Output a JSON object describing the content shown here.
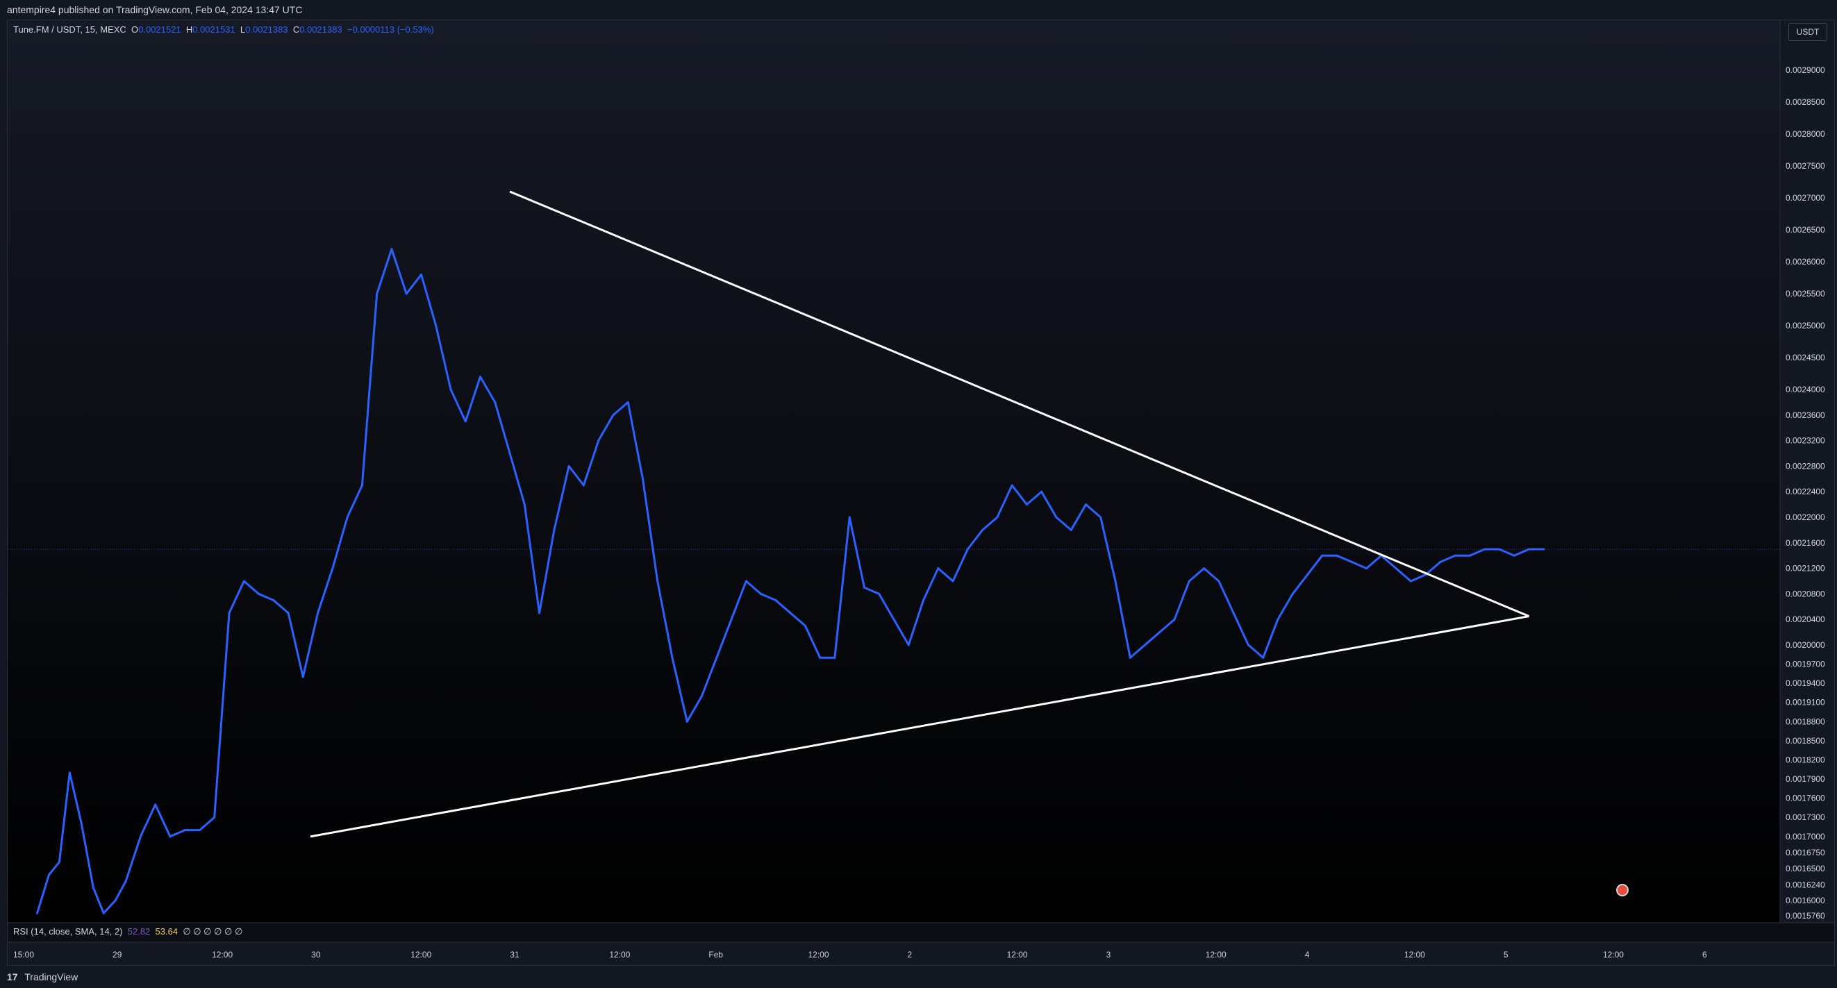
{
  "header": {
    "published": "antempire4 published on TradingView.com, Feb 04, 2024 13:47 UTC"
  },
  "legend": {
    "symbol": "Tune.FM / USDT, 15, MEXC",
    "o_label": "O",
    "o_value": "0.0021521",
    "h_label": "H",
    "h_value": "0.0021531",
    "l_label": "L",
    "l_value": "0.0021383",
    "c_label": "C",
    "c_value": "0.0021383",
    "change": "−0.0000113 (−0.53%)"
  },
  "rsi": {
    "label": "RSI (14, close, SMA, 14, 2)",
    "value1": "52.82",
    "value2": "53.64",
    "placeholders": "∅ ∅ ∅ ∅ ∅ ∅"
  },
  "currency": "USDT",
  "footer": {
    "brand": "TradingView",
    "logo": "17"
  },
  "colors": {
    "background": "#131722",
    "series": "#2962ff",
    "trendline": "#ffffff",
    "grid": "#1e222d",
    "text": "#d1d4dc",
    "crosshair": "#2962ff"
  },
  "chart_data": {
    "type": "line",
    "price_ticks": [
      "0.0029000",
      "0.0028500",
      "0.0028000",
      "0.0027500",
      "0.0027000",
      "0.0026500",
      "0.0026000",
      "0.0025500",
      "0.0025000",
      "0.0024500",
      "0.0024000",
      "0.0023600",
      "0.0023200",
      "0.0022800",
      "0.0022400",
      "0.0022000",
      "0.0021600",
      "0.0021200",
      "0.0020800",
      "0.0020400",
      "0.0020000",
      "0.0019700",
      "0.0019400",
      "0.0019100",
      "0.0018800",
      "0.0018500",
      "0.0018200",
      "0.0017900",
      "0.0017600",
      "0.0017300",
      "0.0017000",
      "0.0016750",
      "0.0016500",
      "0.0016240",
      "0.0016000",
      "0.0015760"
    ],
    "time_ticks": [
      "15:00",
      "29",
      "12:00",
      "30",
      "12:00",
      "31",
      "12:00",
      "Feb",
      "12:00",
      "2",
      "12:00",
      "3",
      "12:00",
      "4",
      "12:00",
      "5",
      "12:00",
      "6"
    ],
    "series": [
      {
        "x": [
          0,
          0.8,
          1.5,
          2.2,
          3,
          3.8,
          4.5,
          5.3,
          6,
          7,
          8,
          9,
          10,
          11,
          12,
          13,
          14,
          15,
          16,
          17,
          18,
          19,
          20,
          21,
          22,
          23,
          24,
          25,
          26,
          27,
          28,
          29,
          30,
          31,
          32,
          33,
          34,
          35,
          36,
          37,
          38,
          39,
          40,
          41,
          42,
          43,
          44,
          45,
          46,
          47,
          48,
          49,
          50,
          51,
          52,
          53,
          54,
          55,
          56,
          57,
          58,
          59,
          60,
          61,
          62,
          63,
          64,
          65,
          66,
          67,
          68,
          69,
          70,
          71,
          72,
          73,
          74,
          75,
          76,
          77,
          78,
          79,
          80,
          81,
          82,
          83,
          84,
          85,
          86,
          87,
          88,
          89,
          90,
          91,
          92,
          93,
          94,
          95,
          96,
          97,
          98,
          99,
          100,
          101,
          102
        ],
        "y": [
          0.00158,
          0.00164,
          0.00166,
          0.0018,
          0.00172,
          0.00162,
          0.00158,
          0.0016,
          0.00163,
          0.0017,
          0.00175,
          0.0017,
          0.00171,
          0.00171,
          0.00173,
          0.00205,
          0.0021,
          0.00208,
          0.00207,
          0.00205,
          0.00195,
          0.00205,
          0.00212,
          0.0022,
          0.00225,
          0.00255,
          0.00262,
          0.00255,
          0.00258,
          0.0025,
          0.0024,
          0.00235,
          0.00242,
          0.00238,
          0.0023,
          0.00222,
          0.00205,
          0.00218,
          0.00228,
          0.00225,
          0.00232,
          0.00236,
          0.00238,
          0.00226,
          0.0021,
          0.00198,
          0.00188,
          0.00192,
          0.00198,
          0.00204,
          0.0021,
          0.00208,
          0.00207,
          0.00205,
          0.00203,
          0.00198,
          0.00198,
          0.0022,
          0.00209,
          0.00208,
          0.00204,
          0.002,
          0.00207,
          0.00212,
          0.0021,
          0.00215,
          0.00218,
          0.0022,
          0.00225,
          0.00222,
          0.00224,
          0.0022,
          0.00218,
          0.00222,
          0.0022,
          0.0021,
          0.00198,
          0.002,
          0.00202,
          0.00204,
          0.0021,
          0.00212,
          0.0021,
          0.00205,
          0.002,
          0.00198,
          0.00204,
          0.00208,
          0.00211,
          0.00214,
          0.00214,
          0.00213,
          0.00212,
          0.00214,
          0.00212,
          0.0021,
          0.00211,
          0.00213,
          0.00214,
          0.00214,
          0.00215,
          0.00215,
          0.00214,
          0.00215,
          0.00215
        ]
      }
    ],
    "trendlines": [
      {
        "x": [
          18.5,
          101
        ],
        "y": [
          0.0017,
          0.002045
        ]
      },
      {
        "x": [
          32,
          101
        ],
        "y": [
          0.00271,
          0.002045
        ]
      }
    ],
    "xlim": [
      -2,
      118
    ],
    "ylim": [
      0.001565,
      0.002935
    ],
    "grid": false
  }
}
